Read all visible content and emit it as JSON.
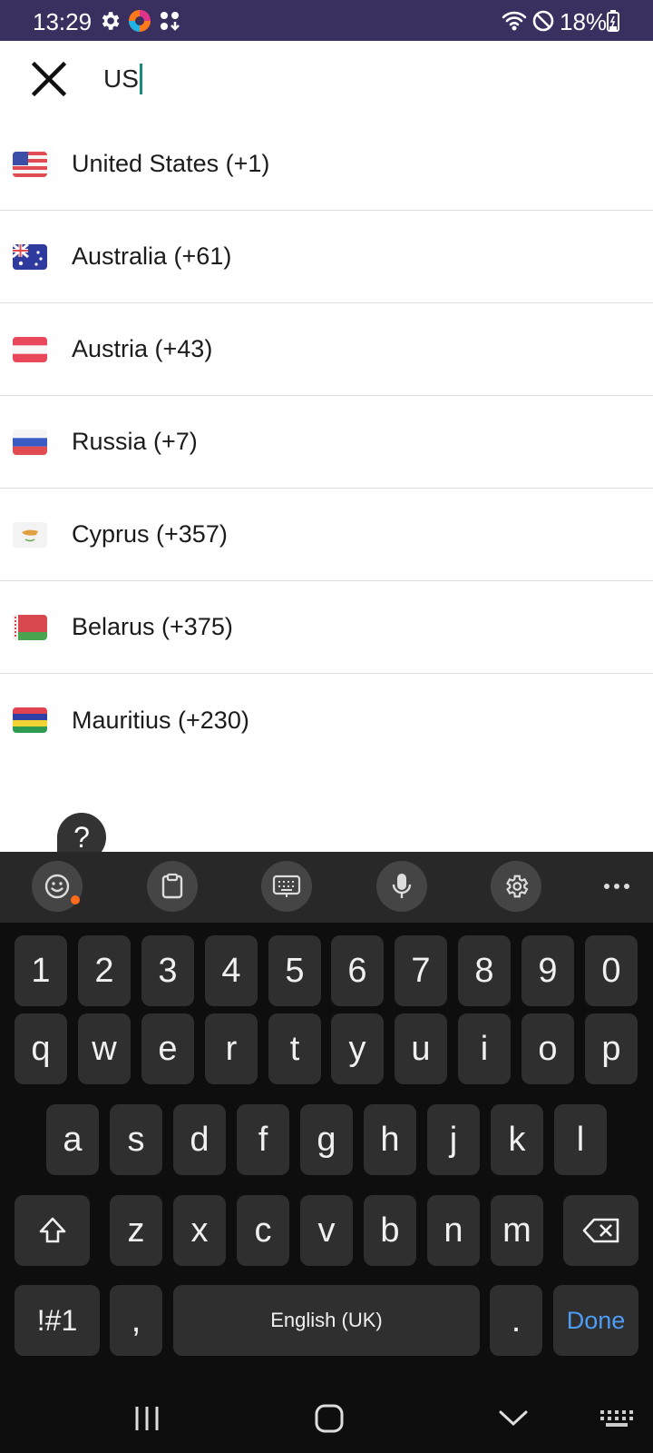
{
  "status_bar": {
    "time": "13:29",
    "battery": "18%",
    "icons": [
      "gear-icon",
      "browser-icon",
      "apps-icon",
      "wifi-icon",
      "do-not-disturb-icon",
      "battery-icon"
    ]
  },
  "search": {
    "close_icon": "close-icon",
    "value": "US"
  },
  "countries": [
    {
      "label": "United States (+1)",
      "flag": "us-flag"
    },
    {
      "label": "Australia (+61)",
      "flag": "australia-flag"
    },
    {
      "label": "Austria (+43)",
      "flag": "austria-flag"
    },
    {
      "label": "Russia (+7)",
      "flag": "russia-flag"
    },
    {
      "label": "Cyprus (+357)",
      "flag": "cyprus-flag"
    },
    {
      "label": "Belarus (+375)",
      "flag": "belarus-flag"
    },
    {
      "label": "Mauritius (+230)",
      "flag": "mauritius-flag"
    }
  ],
  "help": {
    "label": "?"
  },
  "keyboard": {
    "toolbar": [
      "emoji-icon",
      "clipboard-icon",
      "keyboard-icon",
      "microphone-icon",
      "settings-icon",
      "more-icon"
    ],
    "row_numbers": [
      "1",
      "2",
      "3",
      "4",
      "5",
      "6",
      "7",
      "8",
      "9",
      "0"
    ],
    "row_top": [
      "q",
      "w",
      "e",
      "r",
      "t",
      "y",
      "u",
      "i",
      "o",
      "p"
    ],
    "row_middle": [
      "a",
      "s",
      "d",
      "f",
      "g",
      "h",
      "j",
      "k",
      "l"
    ],
    "row_bottom": [
      "z",
      "x",
      "c",
      "v",
      "b",
      "n",
      "m"
    ],
    "symbols_key": "!#1",
    "comma_key": ",",
    "space_key": "English (UK)",
    "period_key": ".",
    "done_key": "Done"
  },
  "nav": [
    "recents-icon",
    "home-icon",
    "back-icon",
    "keyboard-switch-icon"
  ],
  "colors": {
    "status_bar_bg": "#3a3060",
    "accent_caret": "#1a8a7a",
    "keyboard_bg": "#0e0e0e",
    "key_bg": "#2f2f2f",
    "done_color": "#4d9cf5",
    "notification_dot": "#ff6b1a"
  }
}
